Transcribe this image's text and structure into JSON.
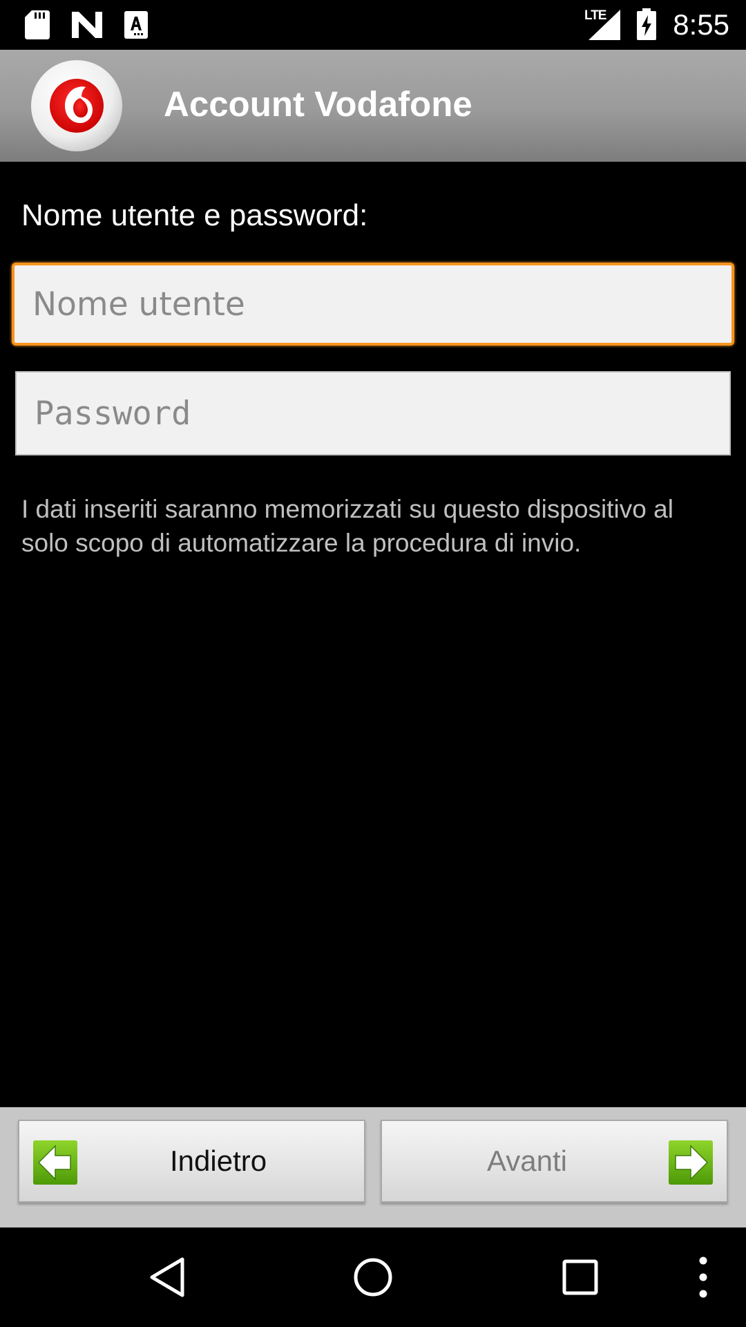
{
  "status_bar": {
    "time": "8:55",
    "network": "LTE",
    "icons": [
      "sd-card-icon",
      "n-icon",
      "a-icon",
      "signal-icon",
      "battery-charging-icon"
    ]
  },
  "header": {
    "title": "Account Vodafone",
    "logo_icon": "vodafone-logo-icon"
  },
  "form": {
    "label": "Nome utente e password:",
    "username_placeholder": "Nome utente",
    "password_placeholder": "Password",
    "info": "I dati inseriti saranno memorizzati su questo dispositivo al solo scopo di automatizzare la procedura di invio."
  },
  "buttons": {
    "back_label": "Indietro",
    "next_label": "Avanti",
    "back_icon": "arrow-left-icon",
    "next_icon": "arrow-right-icon"
  },
  "nav_bar": {
    "icons": [
      "nav-back-icon",
      "nav-home-icon",
      "nav-recents-icon",
      "overflow-menu-icon"
    ]
  },
  "colors": {
    "focus_border": "#f7941d",
    "vodafone_red": "#e60000",
    "arrow_green": "#6bb813",
    "header_gray": "#9a9a9a"
  }
}
